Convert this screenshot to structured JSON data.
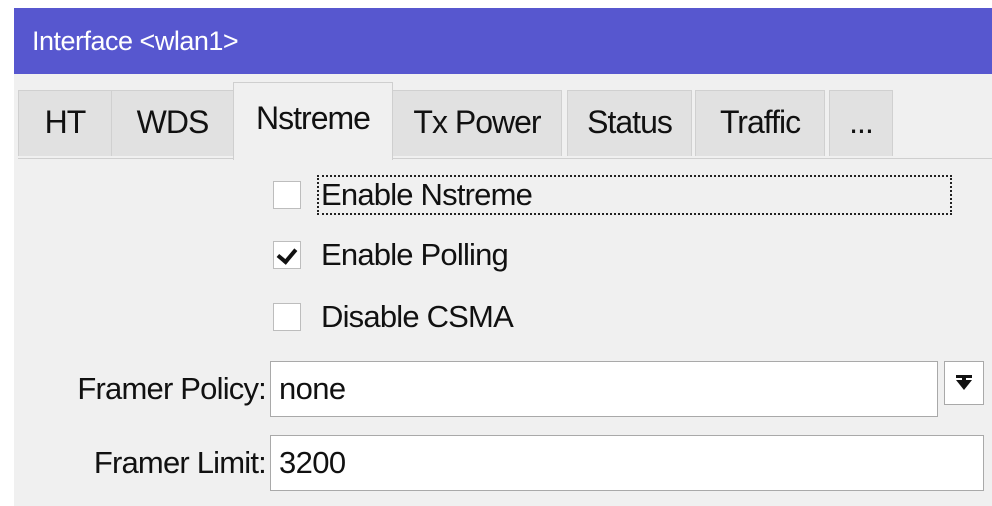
{
  "window": {
    "title": "Interface <wlan1>"
  },
  "tabs": [
    {
      "label": "HT"
    },
    {
      "label": "WDS"
    },
    {
      "label": "Nstreme",
      "active": true
    },
    {
      "label": "Tx Power"
    },
    {
      "label": "Status"
    },
    {
      "label": "Traffic"
    },
    {
      "label": "..."
    }
  ],
  "nstreme": {
    "enable_nstreme": {
      "label": "Enable Nstreme",
      "checked": false
    },
    "enable_polling": {
      "label": "Enable Polling",
      "checked": true
    },
    "disable_csma": {
      "label": "Disable CSMA",
      "checked": false
    },
    "framer_policy": {
      "label": "Framer Policy:",
      "value": "none"
    },
    "framer_limit": {
      "label": "Framer Limit:",
      "value": "3200"
    }
  },
  "colors": {
    "titlebar": "#5757cf",
    "panel": "#f0f0f0",
    "tab_inactive": "#e1e1e1"
  },
  "icons": {
    "dropdown": "dropdown-arrow-icon"
  }
}
